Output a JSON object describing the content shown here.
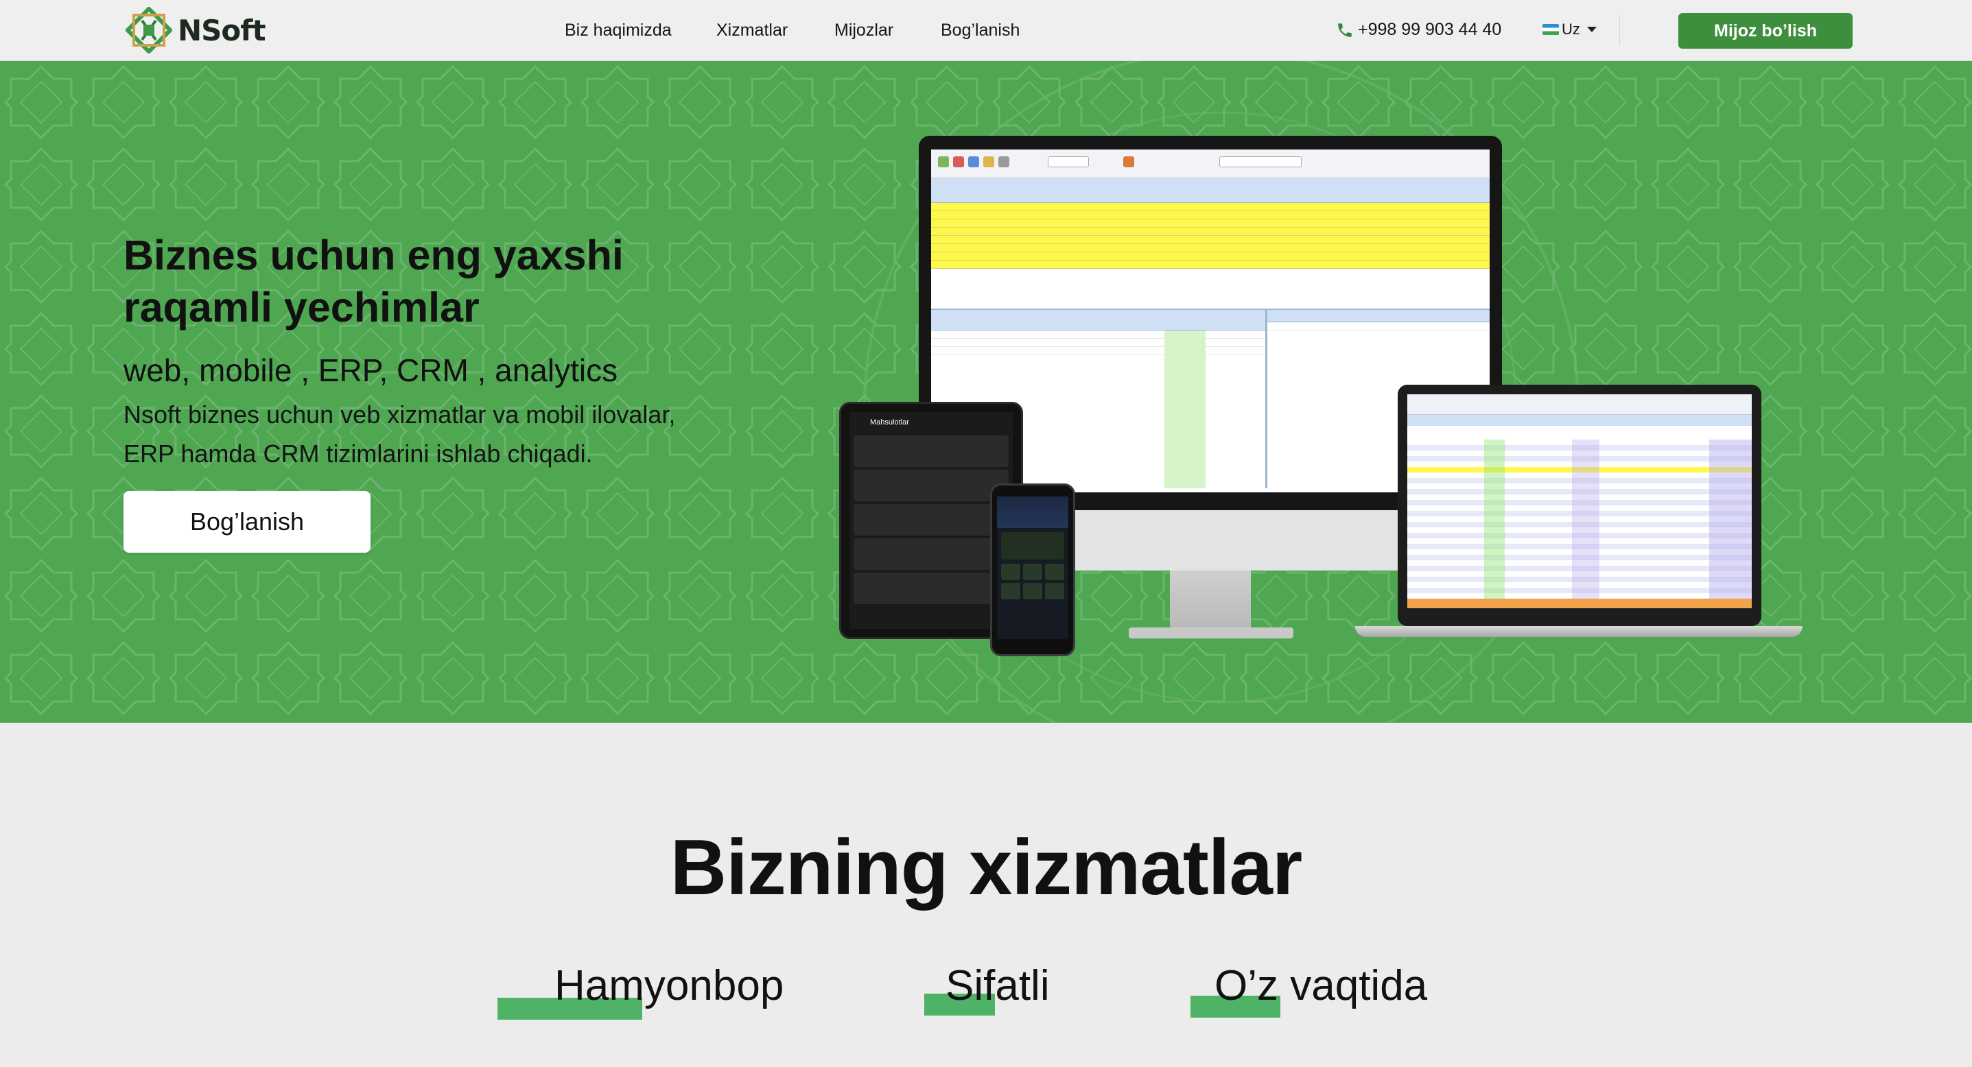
{
  "brand": {
    "name": "NSoft"
  },
  "nav": {
    "items": [
      {
        "label": "Biz haqimizda"
      },
      {
        "label": "Xizmatlar"
      },
      {
        "label": "Mijozlar"
      },
      {
        "label": "Bog’lanish"
      }
    ]
  },
  "contact": {
    "phone": "+998 99 903 44 40"
  },
  "language": {
    "selected": "Uz"
  },
  "header_cta": {
    "label": "Mijoz bo’lish"
  },
  "hero": {
    "title_line1": "Biznes uchun eng yaxshi",
    "title_line2": "raqamli yechimlar",
    "subtitle": "web, mobile , ERP, CRM , analytics",
    "desc_line1": "Nsoft biznes uchun veb xizmatlar va mobil ilovalar,",
    "desc_line2": "ERP hamda CRM tizimlarini ishlab chiqadi.",
    "button_label": "Bog’lanish"
  },
  "mobile_app": {
    "screen_title": "Mahsulotlar"
  },
  "services": {
    "title": "Bizning xizmatlar",
    "features": [
      {
        "label": "Hamyonbop"
      },
      {
        "label": "Sifatli"
      },
      {
        "label": "O’z vaqtida"
      }
    ]
  },
  "colors": {
    "hero_green": "#4fa752",
    "button_green": "#3d8f3d",
    "feature_bar_green": "#4fb367",
    "header_bg": "#efefef",
    "section_bg": "#ececec"
  },
  "icons": [
    "logo-mark-icon",
    "phone-icon",
    "flag-uz-icon",
    "chevron-down-icon"
  ]
}
